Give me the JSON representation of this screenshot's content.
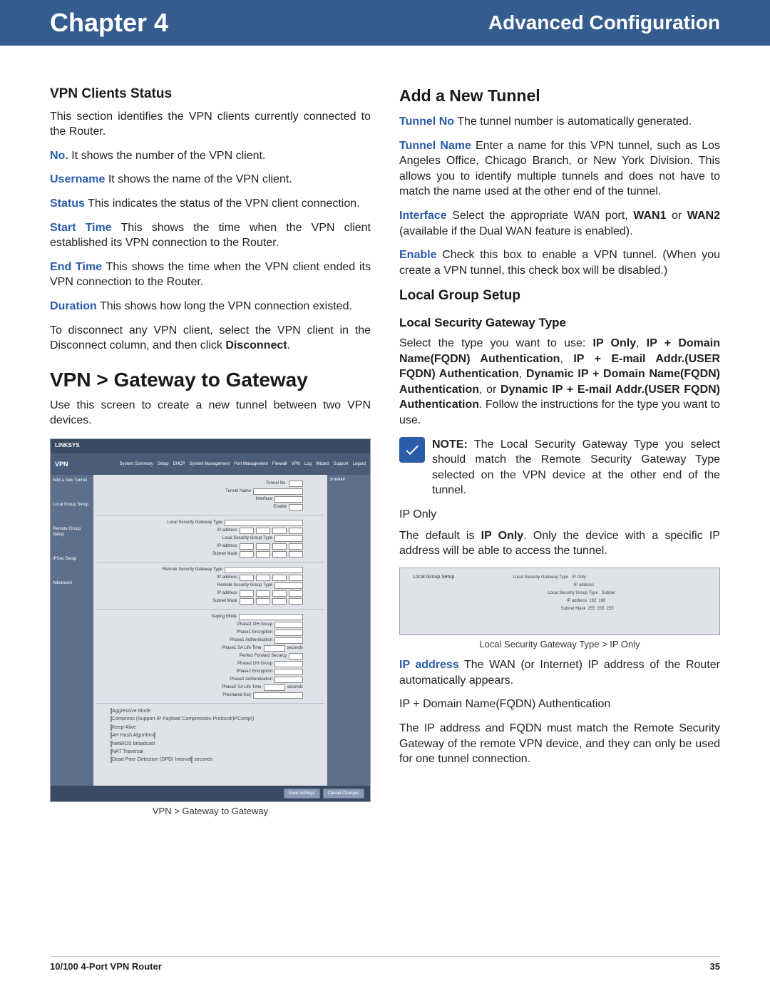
{
  "header": {
    "chapter": "Chapter 4",
    "section": "Advanced Configuration"
  },
  "left": {
    "h_vpn_clients": "VPN Clients Status",
    "p_intro": "This section identifies the VPN clients currently connected to the Router.",
    "lbl_no": "No.",
    "p_no": "  It shows the number of the VPN client.",
    "lbl_username": "Username",
    "p_username": "  It shows the name of the VPN client.",
    "lbl_status": "Status",
    "p_status": " This indicates the status of the VPN client connection.",
    "lbl_start": "Start Time",
    "p_start": " This shows the time when the VPN client established its VPN connection to the Router.",
    "lbl_end": "End Time",
    "p_end": "   This shows the time when the VPN client ended its VPN connection to the Router.",
    "lbl_duration": "Duration",
    "p_duration": " This shows how long the VPN connection existed.",
    "p_disconnect_a": "To disconnect any VPN client, select the VPN client in the Disconnect column, and then click ",
    "p_disconnect_b": "Disconnect",
    "p_disconnect_c": ".",
    "h_gateway": "VPN > Gateway to Gateway",
    "p_gateway": "Use this screen to create a new tunnel between two VPN devices.",
    "caption": "VPN > Gateway to Gateway",
    "shot": {
      "brand": "LINKSYS",
      "vpn": "VPN",
      "tabs": [
        "System Summary",
        "Setup",
        "DHCP",
        "System Management",
        "Port Management",
        "Firewall",
        "VPN",
        "Log",
        "Wizard",
        "Support",
        "Logout"
      ],
      "side": [
        "Add a new Tunnel",
        "Local Group Setup",
        "Remote Group Setup",
        "IPSec Setup",
        "Advanced"
      ],
      "btn_save": "Save Settings",
      "btn_cancel": "Cancel Changes"
    }
  },
  "right": {
    "h_add": "Add a New Tunnel",
    "lbl_tunnel_no": "Tunnel No",
    "p_tunnel_no": " The tunnel number is automatically generated.",
    "lbl_tunnel_name": "Tunnel Name",
    "p_tunnel_name": "  Enter a name for this VPN tunnel, such as Los Angeles Office, Chicago Branch, or New York Division. This allows you to identify multiple tunnels and does not have to match the name used at the other end of the tunnel.",
    "lbl_interface": "Interface",
    "p_interface_a": " Select the appropriate WAN port, ",
    "p_interface_b": "WAN1",
    "p_interface_c": " or ",
    "p_interface_d": "WAN2",
    "p_interface_e": " (available if the Dual WAN feature is enabled).",
    "lbl_enable": "Enable",
    "p_enable": " Check this box to enable a VPN tunnel. (When you create a VPN tunnel, this check box will be disabled.)",
    "h_local_group": "Local Group Setup",
    "h_local_sec": "Local Security Gateway Type",
    "p_select_a": "Select the type you want to use: ",
    "p_select_b": "IP Only",
    "p_select_c": ", ",
    "p_select_d": "IP + Domain Name(FQDN) Authentication",
    "p_select_e": ", ",
    "p_select_f": "IP + E-mail Addr.(USER FQDN) Authentication",
    "p_select_g": ", ",
    "p_select_h": "Dynamic IP + Domain Name(FQDN) Authentication",
    "p_select_i": ", or ",
    "p_select_j": "Dynamic IP + E-mail Addr.(USER FQDN) Authentication",
    "p_select_k": ". Follow the instructions for the type you want to use.",
    "note_label": "NOTE:",
    "note_text": " The Local Security Gateway Type you select should match the Remote Security Gateway Type selected on the VPN device at the other end of the tunnel.",
    "h_iponly": "IP Only",
    "p_iponly_a": "The default is ",
    "p_iponly_b": "IP Only",
    "p_iponly_c": ". Only the device with a specific IP address will be able to access the tunnel.",
    "caption2": "Local Security Gateway Type > IP Only",
    "lbl_ipaddr": "IP address",
    "p_ipaddr": "   The WAN (or Internet) IP address of the Router automatically appears.",
    "p_fqdn_h": "IP + Domain Name(FQDN) Authentication",
    "p_fqdn": "The IP address and FQDN must match the Remote Security Gateway of the remote VPN device, and they can only be used for one tunnel connection.",
    "shot2": {
      "side": "Local Group Setup",
      "row1": "Local Security Gateway Type",
      "row1v": "IP Only",
      "row2": "IP address",
      "row3": "Local Security Group Type",
      "row3v": "Subnet",
      "row4": "IP address",
      "row4v1": "192",
      "row4v2": "168",
      "row5": "Subnet Mask",
      "row5v1": "255",
      "row5v2": "255",
      "row5v3": "255"
    }
  },
  "footer": {
    "product": "10/100 4-Port VPN Router",
    "page": "35"
  }
}
